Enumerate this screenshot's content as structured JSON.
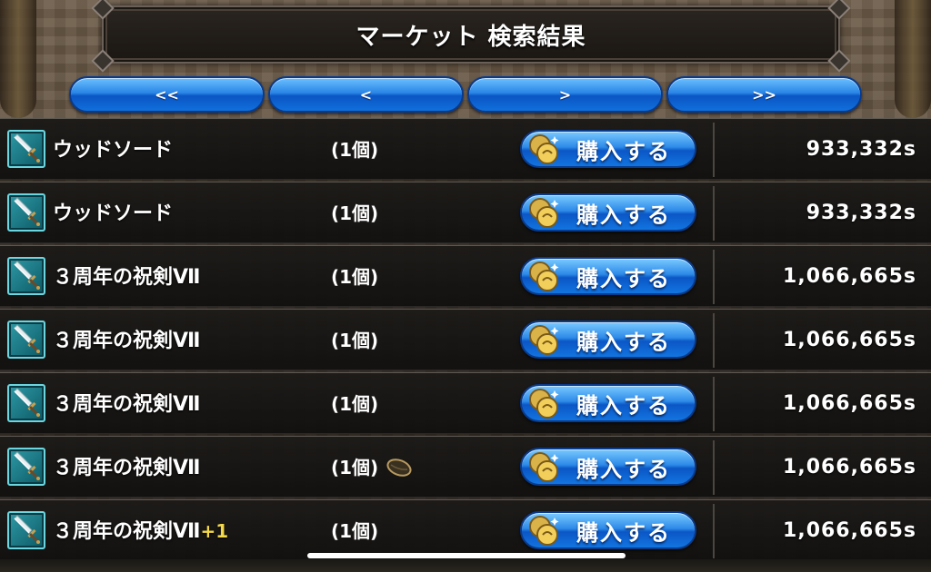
{
  "header": {
    "title": "マーケット 検索結果"
  },
  "nav": {
    "first": "<<",
    "prev": "<",
    "next": ">",
    "last": ">>"
  },
  "colors": {
    "button_blue": "#2a86e6",
    "item_icon_teal": "#2e9aa6",
    "plus_yellow": "#f2d84a"
  },
  "buy_label": "購入する",
  "rows": [
    {
      "name": "ウッドソード",
      "suffix": "",
      "qty": "(1個)",
      "price": "933,332s",
      "icon": "sword-icon",
      "has_seed": false
    },
    {
      "name": "ウッドソード",
      "suffix": "",
      "qty": "(1個)",
      "price": "933,332s",
      "icon": "sword-icon",
      "has_seed": false
    },
    {
      "name": "３周年の祝剣Ⅶ",
      "suffix": "",
      "qty": "(1個)",
      "price": "1,066,665s",
      "icon": "sword-icon",
      "has_seed": false
    },
    {
      "name": "３周年の祝剣Ⅶ",
      "suffix": "",
      "qty": "(1個)",
      "price": "1,066,665s",
      "icon": "sword-icon",
      "has_seed": false
    },
    {
      "name": "３周年の祝剣Ⅶ",
      "suffix": "",
      "qty": "(1個)",
      "price": "1,066,665s",
      "icon": "sword-icon",
      "has_seed": false
    },
    {
      "name": "３周年の祝剣Ⅶ",
      "suffix": "",
      "qty": "(1個)",
      "price": "1,066,665s",
      "icon": "sword-icon",
      "has_seed": true
    },
    {
      "name": "３周年の祝剣Ⅶ",
      "suffix": "+1",
      "qty": "(1個)",
      "price": "1,066,665s",
      "icon": "sword-icon",
      "has_seed": false
    }
  ]
}
